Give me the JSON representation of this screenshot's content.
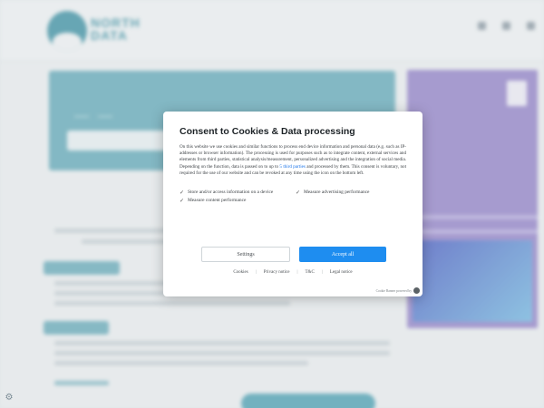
{
  "dialog": {
    "title": "Consent to Cookies & Data processing",
    "body_before_link": "On this website we use cookies and similar functions to process end device information and personal data (e.g. such as IP-addresses or browser information). The processing is used for purposes such as to integrate content, external services and elements from third parties, statistical analysis/measurement, personalized advertising and the integration of social media. Depending on the function, data is passed on to up to ",
    "body_link": "5 third parties",
    "body_after_link": " and processed by them. This consent is voluntary, not required for the use of our website and can be revoked at any time using the icon on the bottom left.",
    "options": [
      "Store and/or access information on a device",
      "Measure advertising performance",
      "Measure content performance"
    ],
    "settings_label": "Settings",
    "accept_label": "Accept all",
    "links": [
      "Cookies",
      "Privacy notice",
      "T&C",
      "Legal notice"
    ],
    "powered_by": "Cookie Banner powered by"
  },
  "icons": {
    "checkbox": "checkmark-icon",
    "consent_settings": "cookie-settings-icon"
  },
  "colors": {
    "accent": "#1e8df0",
    "brand_teal": "#2f8ca0",
    "promo_purple": "#8f7bc9"
  }
}
